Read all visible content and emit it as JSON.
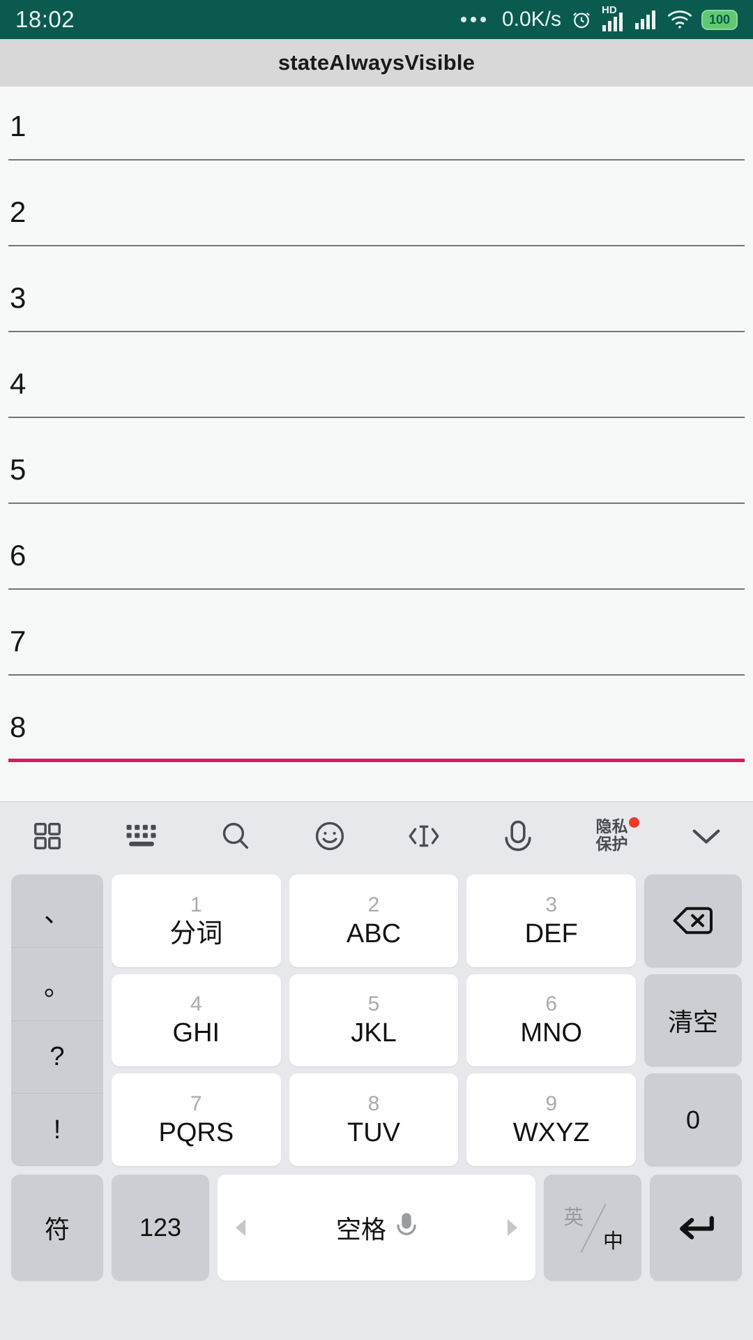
{
  "status_bar": {
    "time": "18:02",
    "overflow_icon": "more-dots-icon",
    "network_speed": "0.0K/s",
    "alarm_icon": "alarm-clock-icon",
    "hd_label": "HD",
    "signal_1_icon": "signal-bars-icon",
    "signal_2_icon": "signal-bars-icon",
    "wifi_icon": "wifi-icon",
    "battery_level": "100",
    "background_color": "#0a5a4f"
  },
  "title_bar": {
    "title": "stateAlwaysVisible",
    "background_color": "#d8d8d8"
  },
  "form": {
    "focused_index": 7,
    "focus_underline_color": "#d81b60",
    "fields": [
      {
        "value": "1",
        "placeholder": ""
      },
      {
        "value": "2",
        "placeholder": ""
      },
      {
        "value": "3",
        "placeholder": ""
      },
      {
        "value": "4",
        "placeholder": ""
      },
      {
        "value": "5",
        "placeholder": ""
      },
      {
        "value": "6",
        "placeholder": ""
      },
      {
        "value": "7",
        "placeholder": ""
      },
      {
        "value": "8",
        "placeholder": ""
      }
    ]
  },
  "keyboard": {
    "background_color": "#e7e8ec",
    "toolbar": [
      {
        "name": "apps-grid-icon",
        "label": ""
      },
      {
        "name": "keyboard-icon",
        "label": ""
      },
      {
        "name": "search-icon",
        "label": ""
      },
      {
        "name": "emoji-icon",
        "label": ""
      },
      {
        "name": "cursor-move-icon",
        "label": ""
      },
      {
        "name": "microphone-icon",
        "label": ""
      },
      {
        "name": "privacy-protection",
        "label": "隐私\n保护",
        "label_line1": "隐私",
        "label_line2": "保护",
        "badge": true
      },
      {
        "name": "collapse-keyboard-icon",
        "label": ""
      }
    ],
    "punctuation_column": [
      "、",
      "。",
      "?",
      "!"
    ],
    "number_keys": [
      {
        "num": "1",
        "label": "分词"
      },
      {
        "num": "2",
        "label": "ABC"
      },
      {
        "num": "3",
        "label": "DEF"
      },
      {
        "num": "4",
        "label": "GHI"
      },
      {
        "num": "5",
        "label": "JKL"
      },
      {
        "num": "6",
        "label": "MNO"
      },
      {
        "num": "7",
        "label": "PQRS"
      },
      {
        "num": "8",
        "label": "TUV"
      },
      {
        "num": "9",
        "label": "WXYZ"
      }
    ],
    "function_column": [
      {
        "name": "backspace-key",
        "label": ""
      },
      {
        "name": "clear-key",
        "label": "清空"
      },
      {
        "name": "zero-key",
        "label": "0"
      }
    ],
    "bottom_row": {
      "symbols_label": "符",
      "numbers_label": "123",
      "space_label": "空格",
      "space_mic_icon": "microphone-icon",
      "lang_en": "英",
      "lang_cn": "中",
      "enter_icon": "enter-key-icon"
    }
  }
}
